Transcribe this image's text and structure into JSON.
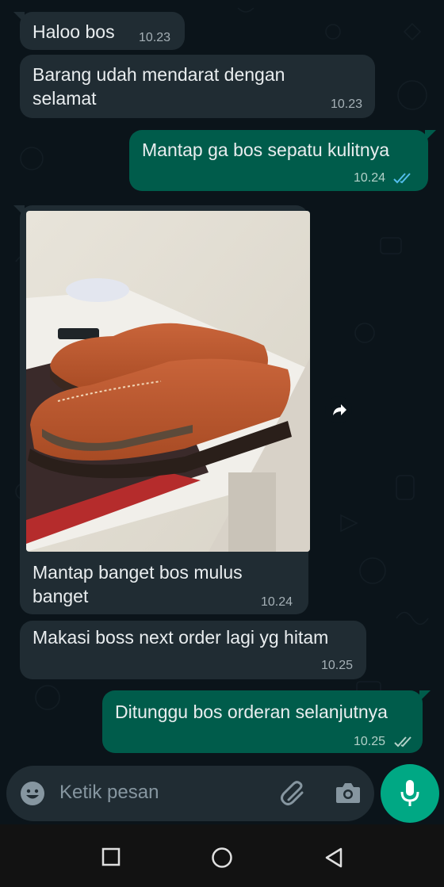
{
  "messages": [
    {
      "direction": "in",
      "text": "Haloo bos",
      "time": "10.23"
    },
    {
      "direction": "in",
      "text_line1": "Barang udah mendarat dengan",
      "text_line2": "selamat",
      "time": "10.23"
    },
    {
      "direction": "out",
      "text": "Mantap ga bos sepatu kulitnya",
      "time": "10.24",
      "status": "read"
    },
    {
      "direction": "in",
      "type": "image",
      "caption_line1": "Mantap banget bos mulus",
      "caption_line2": "banget",
      "time": "10.24"
    },
    {
      "direction": "in",
      "text": "Makasi boss next order lagi yg hitam",
      "time": "10.25"
    },
    {
      "direction": "out",
      "text": "Ditunggu bos orderan selanjutnya",
      "time": "10.25",
      "status": "delivered"
    }
  ],
  "composer": {
    "placeholder": "Ketik pesan"
  },
  "colors": {
    "background": "#0b141a",
    "incoming_bubble": "#202c33",
    "outgoing_bubble": "#005c4b",
    "read_ticks": "#53bdeb",
    "accent": "#00a884"
  },
  "icons": {
    "emoji": "emoji-icon",
    "attach": "paperclip-icon",
    "camera": "camera-icon",
    "mic": "mic-icon",
    "forward": "forward-icon",
    "nav_recents": "square-icon",
    "nav_home": "circle-icon",
    "nav_back": "triangle-back-icon"
  }
}
